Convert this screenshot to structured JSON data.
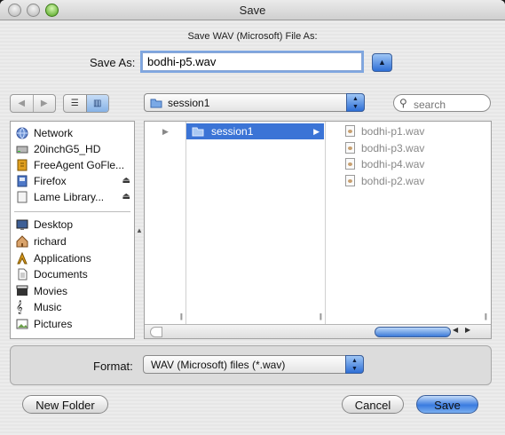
{
  "window": {
    "title": "Save"
  },
  "dialog": {
    "subtitle": "Save WAV (Microsoft) File As:",
    "save_as_label": "Save As:",
    "save_as_value": "bodhi-p5.wav"
  },
  "toolbar": {
    "back_icon": "back-arrow-icon",
    "forward_icon": "forward-arrow-icon",
    "list_view_icon": "list-view-icon",
    "column_view_icon": "column-view-icon",
    "current_folder": "session1",
    "search_placeholder": "search"
  },
  "sidebar": {
    "devices": [
      {
        "label": "Network",
        "icon": "globe-icon"
      },
      {
        "label": "20inchG5_HD",
        "icon": "hard-drive-icon"
      },
      {
        "label": "FreeAgent GoFle...",
        "icon": "external-drive-icon"
      },
      {
        "label": "Firefox",
        "icon": "disk-image-icon",
        "eject": true
      },
      {
        "label": "Lame Library...",
        "icon": "disk-image-icon",
        "eject": true
      }
    ],
    "places": [
      {
        "label": "Desktop",
        "icon": "desktop-icon"
      },
      {
        "label": "richard",
        "icon": "home-icon"
      },
      {
        "label": "Applications",
        "icon": "applications-icon"
      },
      {
        "label": "Documents",
        "icon": "documents-icon"
      },
      {
        "label": "Movies",
        "icon": "movies-icon"
      },
      {
        "label": "Music",
        "icon": "music-icon"
      },
      {
        "label": "Pictures",
        "icon": "pictures-icon"
      }
    ]
  },
  "browser": {
    "selected_folder": "session1",
    "files": [
      "bodhi-p1.wav",
      "bodhi-p3.wav",
      "bodhi-p4.wav",
      "bohdi-p2.wav"
    ]
  },
  "format": {
    "label": "Format:",
    "value": "WAV (Microsoft) files (*.wav)"
  },
  "buttons": {
    "new_folder": "New Folder",
    "cancel": "Cancel",
    "save": "Save"
  },
  "colors": {
    "selection": "#3b74d6",
    "accent": "#2e6fd6"
  }
}
